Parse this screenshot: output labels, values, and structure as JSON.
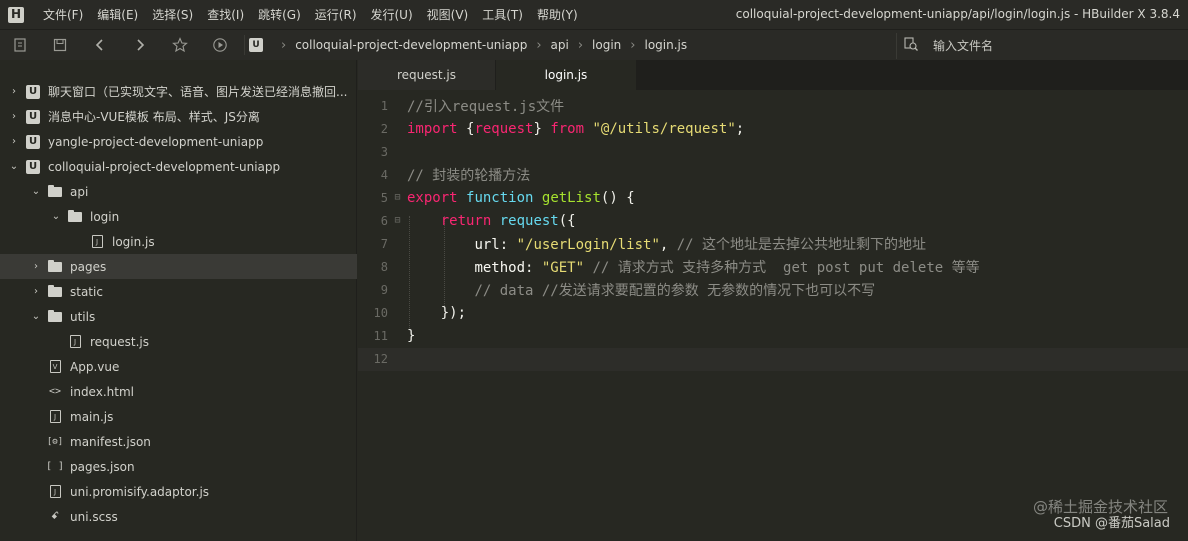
{
  "menubar": {
    "items": [
      "文件(F)",
      "编辑(E)",
      "选择(S)",
      "查找(I)",
      "跳转(G)",
      "运行(R)",
      "发行(U)",
      "视图(V)",
      "工具(T)",
      "帮助(Y)"
    ],
    "window_title": "colloquial-project-development-uniapp/api/login/login.js - HBuilder X 3.8.4"
  },
  "toolbar": {
    "breadcrumb": [
      "colloquial-project-development-uniapp",
      "api",
      "login",
      "login.js"
    ],
    "search_placeholder": "输入文件名",
    "icons": [
      "new-file-icon",
      "save-icon",
      "back-icon",
      "forward-icon",
      "star-icon",
      "run-icon"
    ]
  },
  "sidebar": {
    "items": [
      {
        "label": "聊天窗口（已实现文字、语音、图片发送已经消息撤回...",
        "arrow": "›",
        "icon": "project",
        "indent": 0
      },
      {
        "label": "消息中心-VUE模板 布局、样式、JS分离",
        "arrow": "›",
        "icon": "project",
        "indent": 0
      },
      {
        "label": "yangle-project-development-uniapp",
        "arrow": "›",
        "icon": "project",
        "indent": 0
      },
      {
        "label": "colloquial-project-development-uniapp",
        "arrow": "⌄",
        "icon": "project",
        "indent": 0
      },
      {
        "label": "api",
        "arrow": "⌄",
        "icon": "folder",
        "indent": 1
      },
      {
        "label": "login",
        "arrow": "⌄",
        "icon": "folder",
        "indent": 2
      },
      {
        "label": "login.js",
        "arrow": "",
        "icon": "js",
        "indent": 3
      },
      {
        "label": "pages",
        "arrow": "›",
        "icon": "folder",
        "indent": 1
      },
      {
        "label": "static",
        "arrow": "›",
        "icon": "folder",
        "indent": 1
      },
      {
        "label": "utils",
        "arrow": "⌄",
        "icon": "folder",
        "indent": 1
      },
      {
        "label": "request.js",
        "arrow": "",
        "icon": "js",
        "indent": 2
      },
      {
        "label": "App.vue",
        "arrow": "",
        "icon": "vue",
        "indent": 1
      },
      {
        "label": "index.html",
        "arrow": "",
        "icon": "html",
        "indent": 1
      },
      {
        "label": "main.js",
        "arrow": "",
        "icon": "js",
        "indent": 1
      },
      {
        "label": "manifest.json",
        "arrow": "",
        "icon": "manifest",
        "indent": 1
      },
      {
        "label": "pages.json",
        "arrow": "",
        "icon": "json",
        "indent": 1
      },
      {
        "label": "uni.promisify.adaptor.js",
        "arrow": "",
        "icon": "js",
        "indent": 1
      },
      {
        "label": "uni.scss",
        "arrow": "",
        "icon": "scss",
        "indent": 1
      }
    ],
    "selected_label": "pages"
  },
  "tabs": [
    {
      "label": "request.js",
      "active": false
    },
    {
      "label": "login.js",
      "active": true
    }
  ],
  "editor": {
    "lines": [
      {
        "n": "1",
        "fold": "",
        "tokens": [
          [
            "c-comment",
            "//引入request.js文件"
          ]
        ]
      },
      {
        "n": "2",
        "fold": "",
        "tokens": [
          [
            "c-kw",
            "import"
          ],
          [
            "c-punc",
            " {"
          ],
          [
            "c-kw",
            "request"
          ],
          [
            "c-punc",
            "} "
          ],
          [
            "c-kw",
            "from"
          ],
          [
            "c-punc",
            " "
          ],
          [
            "c-str",
            "\"@/utils/request\""
          ],
          [
            "c-punc",
            ";"
          ]
        ]
      },
      {
        "n": "3",
        "fold": "",
        "tokens": []
      },
      {
        "n": "4",
        "fold": "",
        "tokens": [
          [
            "c-comment",
            "// 封装的轮播方法"
          ]
        ]
      },
      {
        "n": "5",
        "fold": "⊟",
        "tokens": [
          [
            "c-kw",
            "export"
          ],
          [
            "c-punc",
            " "
          ],
          [
            "c-ident",
            "function"
          ],
          [
            "c-punc",
            " "
          ],
          [
            "c-fn",
            "getList"
          ],
          [
            "c-punc",
            "() {"
          ]
        ]
      },
      {
        "n": "6",
        "fold": "⊟",
        "tokens": [
          [
            "c-punc",
            "    "
          ],
          [
            "c-kw",
            "return"
          ],
          [
            "c-punc",
            " "
          ],
          [
            "c-ident",
            "request"
          ],
          [
            "c-punc",
            "({"
          ]
        ]
      },
      {
        "n": "7",
        "fold": "",
        "tokens": [
          [
            "c-punc",
            "        "
          ],
          [
            "c-prop",
            "url"
          ],
          [
            "c-punc",
            ": "
          ],
          [
            "c-str",
            "\"/userLogin/list\""
          ],
          [
            "c-punc",
            ", "
          ],
          [
            "c-comment",
            "// 这个地址是去掉公共地址剩下的地址"
          ]
        ]
      },
      {
        "n": "8",
        "fold": "",
        "tokens": [
          [
            "c-punc",
            "        "
          ],
          [
            "c-prop",
            "method"
          ],
          [
            "c-punc",
            ": "
          ],
          [
            "c-str",
            "\"GET\""
          ],
          [
            "c-punc",
            " "
          ],
          [
            "c-comment",
            "// 请求方式 支持多种方式  get post put delete 等等"
          ]
        ]
      },
      {
        "n": "9",
        "fold": "",
        "tokens": [
          [
            "c-punc",
            "        "
          ],
          [
            "c-comment",
            "// data //发送请求要配置的参数 无参数的情况下也可以不写"
          ]
        ]
      },
      {
        "n": "10",
        "fold": "",
        "tokens": [
          [
            "c-punc",
            "    });"
          ]
        ]
      },
      {
        "n": "11",
        "fold": "",
        "tokens": [
          [
            "c-punc",
            "}"
          ]
        ]
      },
      {
        "n": "12",
        "fold": "",
        "tokens": []
      }
    ]
  },
  "watermark": {
    "line1": "@稀土掘金技术社区",
    "line2": "CSDN @番茄Salad"
  }
}
